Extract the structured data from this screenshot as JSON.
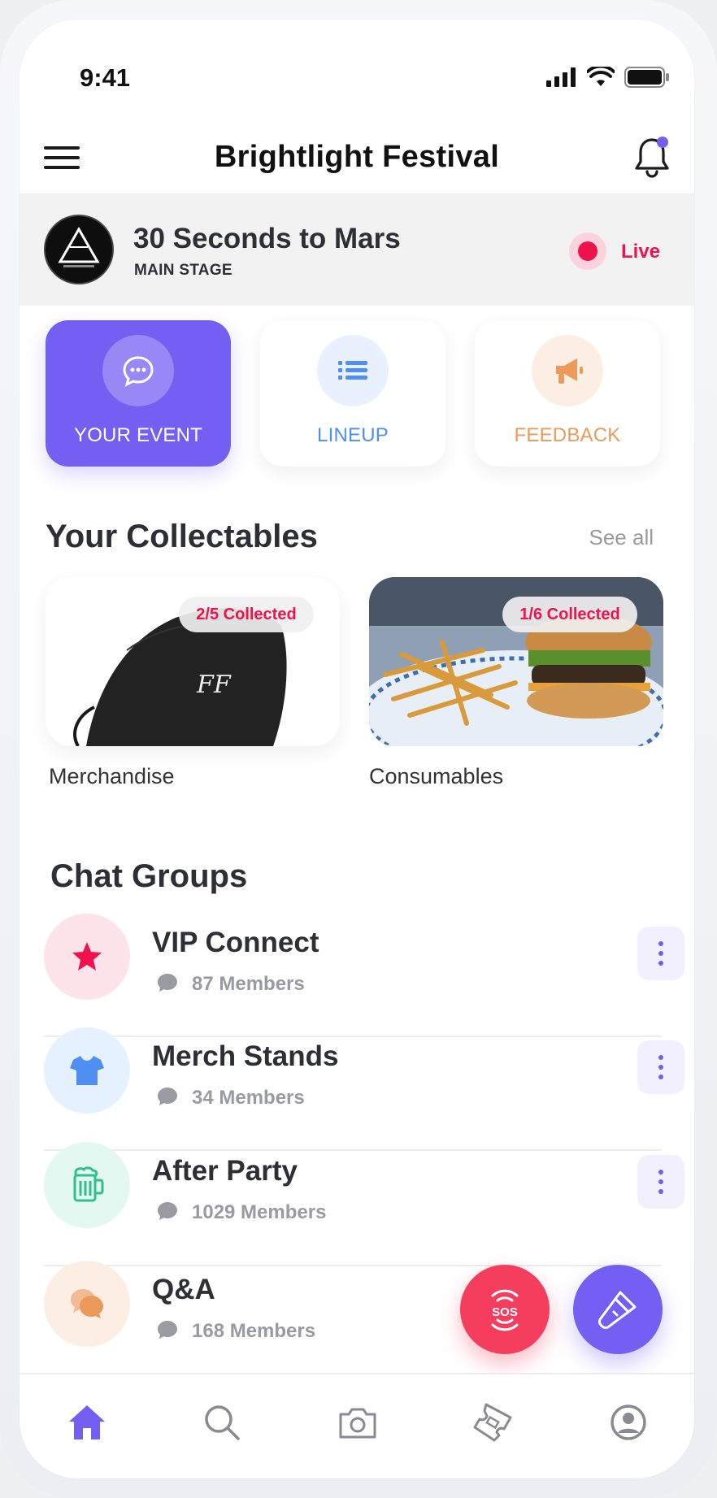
{
  "status_bar": {
    "time": "9:41"
  },
  "header": {
    "title": "Brightlight Festival"
  },
  "now_playing": {
    "artist": "30 Seconds to Mars",
    "stage": "MAIN STAGE",
    "live_label": "Live"
  },
  "actions": [
    {
      "label": "YOUR EVENT",
      "icon": "chat-bubble-icon",
      "active": true
    },
    {
      "label": "LINEUP",
      "icon": "list-icon",
      "color": "#4f8ef2"
    },
    {
      "label": "FEEDBACK",
      "icon": "megaphone-icon",
      "color": "#ec9a5a"
    }
  ],
  "collectables": {
    "title": "Your Collectables",
    "see_all": "See all",
    "items": [
      {
        "label": "Merchandise",
        "badge": "2/5 Collected"
      },
      {
        "label": "Consumables",
        "badge": "1/6 Collected"
      }
    ]
  },
  "chat_groups": {
    "title": "Chat Groups",
    "items": [
      {
        "name": "VIP Connect",
        "members": "87 Members",
        "icon": "star-icon",
        "bg": "#fde4ea",
        "color": "#f0124c"
      },
      {
        "name": "Merch Stands",
        "members": "34 Members",
        "icon": "tshirt-icon",
        "bg": "#e6f1ff",
        "color": "#4f8ef2"
      },
      {
        "name": "After Party",
        "members": "1029 Members",
        "icon": "beer-mug-icon",
        "bg": "#e3f8f0",
        "color": "#2fc08e"
      },
      {
        "name": "Q&A",
        "members": "168 Members",
        "icon": "chat-bubbles-icon",
        "bg": "#fdeee3",
        "color": "#ec9a5a"
      }
    ]
  },
  "fabs": {
    "sos_label": "SOS"
  },
  "colors": {
    "accent": "#7360f2",
    "live": "#f0124c"
  }
}
